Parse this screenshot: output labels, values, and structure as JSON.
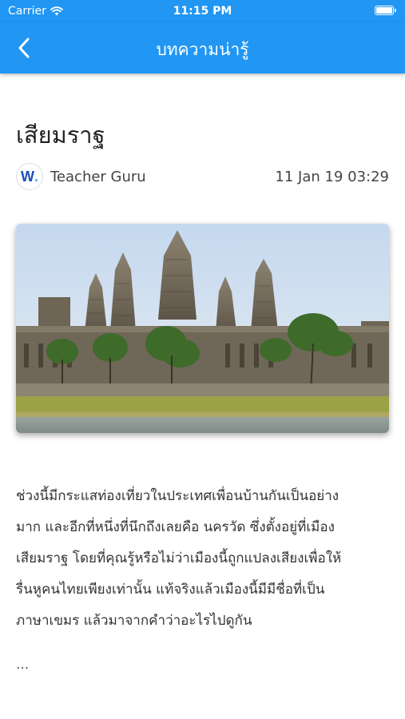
{
  "status_bar": {
    "carrier": "Carrier",
    "time": "11:15 PM",
    "battery_level": 1.0
  },
  "nav": {
    "title": "บทความน่ารู้"
  },
  "article": {
    "title": "เสียมราฐ",
    "author": {
      "avatar_text": "W",
      "avatar_dot": ".",
      "name": "Teacher Guru"
    },
    "date": "11 Jan 19 03:29",
    "body_lines": [
      "ช่วงนี้มีกระแสท่องเที่ยวในประเทศเพื่อนบ้านกันเป็นอย่าง",
      "มาก และอีกที่หนึ่งที่นึกถึงเลยคือ นครวัด ซึ่งตั้งอยู่ที่เมือง",
      "เสียมราฐ โดยที่คุณรู้หรือไม่ว่าเมืองนี้ถูกแปลงเสียงเพื่อให้",
      "รื่นหูคนไทยเพียงเท่านั้น แท้จริงแล้วเมืองนี้มีมีชื่อที่เป็น",
      "ภาษาเขมร แล้วมาจากคำว่าอะไรไปดูกัน"
    ],
    "ellipsis": "..."
  },
  "colors": {
    "primary": "#2196f3"
  },
  "icons": {
    "wifi": "wifi-icon",
    "battery": "battery-icon",
    "back": "chevron-left-icon"
  }
}
